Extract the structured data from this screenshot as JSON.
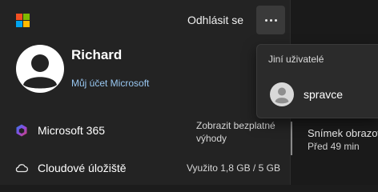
{
  "header": {
    "logo_colors": [
      "#f25022",
      "#7fba00",
      "#00a4ef",
      "#ffb900"
    ],
    "sign_out_label": "Odhlásit se",
    "more_icon": "more-horizontal-icon"
  },
  "profile": {
    "name": "Richard",
    "account_link": "Můj účet Microsoft",
    "avatar_icon": "person-avatar-icon"
  },
  "apps": [
    {
      "label": "Microsoft 365",
      "action_text": "Zobrazit bezplatné výhody",
      "icon": "microsoft-365-icon"
    },
    {
      "label": "Cloudové úložiště",
      "action_text": "Využito 1,8 GB / 5 GB",
      "icon": "cloud-icon"
    }
  ],
  "other_users": {
    "header": "Jiní uživatelé",
    "users": [
      {
        "name": "spravce",
        "icon": "user-icon"
      }
    ]
  },
  "background": {
    "notification_title": "Snímek obrazovi",
    "notification_time": "Před 49 min"
  },
  "colors": {
    "panel_bg": "#232323",
    "link": "#99c8f2",
    "popup_bg": "#2b2b2b"
  }
}
